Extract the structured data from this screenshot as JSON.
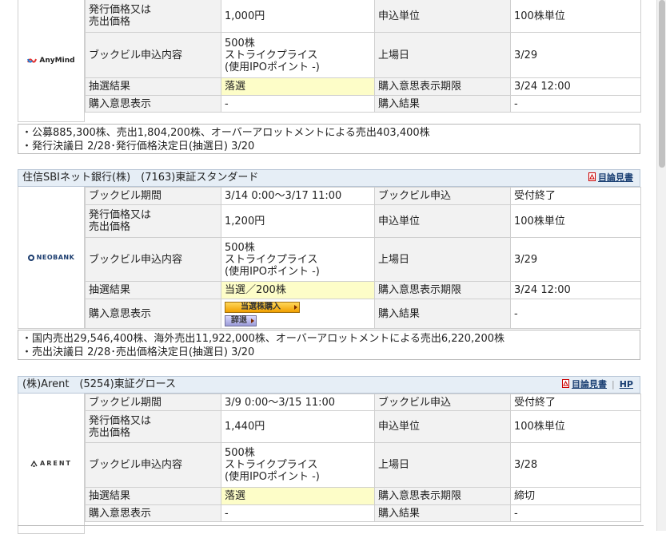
{
  "labels": {
    "period": "ブックビル期間",
    "bookbuild_apply": "ブックビル申込",
    "price": "発行価格又は\n売出価格",
    "unit": "申込単位",
    "content": "ブックビル申込内容",
    "listing": "上場日",
    "lottery": "抽選結果",
    "deadline": "購入意思表示期限",
    "intent": "購入意思表示",
    "purchase": "購入結果"
  },
  "block1": {
    "logo": "AnyMind",
    "price": "1,000円",
    "unit": "100株単位",
    "content": "500株\nストライクプライス\n(使用IPOポイント -)",
    "listing": "3/29",
    "lottery": "落選",
    "deadline": "3/24 12:00",
    "intent": "-",
    "purchase": "-",
    "note_line1": "・公募885,300株、売出1,804,200株、オーバーアロットメントによる売出403,400株",
    "note_line2": "・発行決議日 2/28･発行価格決定日(抽選日) 3/20"
  },
  "block2": {
    "title": "住信SBIネット銀行(株)　(7163)東証スタンダード",
    "link_prospectus": "目論見書",
    "logo": "NEOBANK",
    "period": "3/14 0:00〜3/17 11:00",
    "bookbuild_apply": "受付終了",
    "price": "1,200円",
    "unit": "100株単位",
    "content": "500株\nストライクプライス\n(使用IPOポイント -)",
    "listing": "3/29",
    "lottery": "当選／200株",
    "deadline": "3/24 12:00",
    "btn_buy": "当選株購入",
    "btn_decline": "辞退",
    "purchase": "-",
    "note_line1": "・国内売出29,546,400株、海外売出11,922,000株、オーバーアロットメントによる売出6,220,200株",
    "note_line2": "・売出決議日 2/28･売出価格決定日(抽選日) 3/20"
  },
  "block3": {
    "title": "(株)Arent　(5254)東証グロース",
    "link_prospectus": "目論見書",
    "link_hp": "HP",
    "logo": "ARENT",
    "period": "3/9 0:00〜3/15 11:00",
    "bookbuild_apply": "受付終了",
    "price": "1,440円",
    "unit": "100株単位",
    "content": "500株\nストライクプライス\n(使用IPOポイント -)",
    "listing": "3/28",
    "lottery": "落選",
    "deadline": "締切",
    "intent": "-",
    "purchase": "-"
  },
  "colors": {
    "header_bg": "#e6eef6",
    "label_bg": "#f2f2f2",
    "highlight_bg": "#fdfdc8",
    "link": "#1a3f73"
  }
}
